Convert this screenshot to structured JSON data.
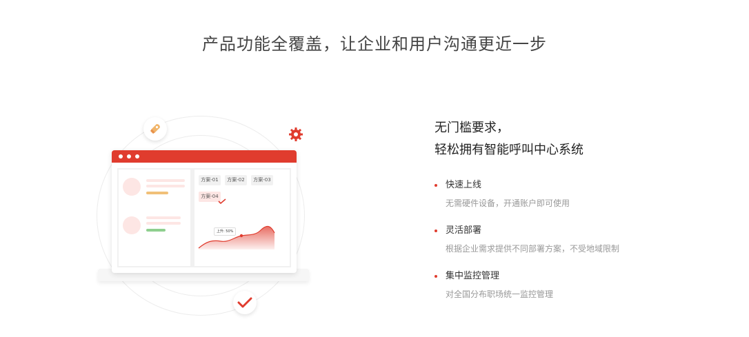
{
  "page": {
    "title": "产品功能全覆盖，让企业和用户沟通更近一步"
  },
  "illustration": {
    "chips": [
      "方案-01",
      "方案-02",
      "方案-03",
      "方案-04"
    ],
    "chart_tag": "上升: 50%",
    "icons": [
      "rocket-icon",
      "gear-icon",
      "checkmark-icon"
    ],
    "colors": {
      "accent": "#e03c2e",
      "orange_bar": "#f1c078",
      "green_bar": "#8fcf8f",
      "pale_red": "#fde6e4"
    }
  },
  "features": {
    "headline_line1": "无门槛要求，",
    "headline_line2": "轻松拥有智能呼叫中心系统",
    "items": [
      {
        "title": "快速上线",
        "desc": "无需硬件设备，开通账户即可使用"
      },
      {
        "title": "灵活部署",
        "desc": "根据企业需求提供不同部署方案，不受地域限制"
      },
      {
        "title": "集中监控管理",
        "desc": "对全国分布职场统一监控管理"
      }
    ]
  }
}
